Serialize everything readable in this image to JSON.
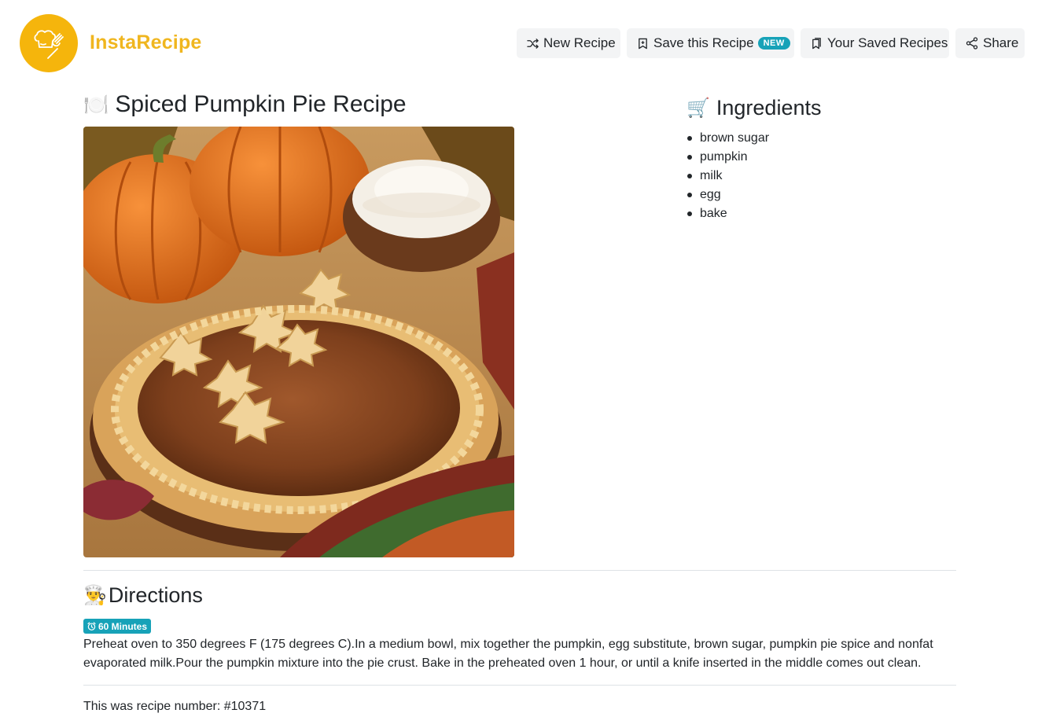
{
  "header": {
    "brand": "InstaRecipe",
    "buttons": {
      "new_recipe": "New Recipe",
      "save_recipe": "Save this Recipe",
      "save_badge": "NEW",
      "saved_recipes": "Your Saved Recipes",
      "share": "Share"
    }
  },
  "recipe": {
    "title_emoji": "🍽️",
    "title": "Spiced Pumpkin Pie Recipe",
    "ingredients_emoji": "🛒",
    "ingredients_heading": "Ingredients",
    "ingredients": [
      "brown sugar",
      "pumpkin",
      "milk",
      "egg",
      "bake"
    ],
    "directions_emoji": "👨‍🍳",
    "directions_heading": "Directions",
    "time": "60 Minutes",
    "directions": "Preheat oven to 350 degrees F (175 degrees C).In a medium bowl, mix together the pumpkin, egg substitute, brown sugar, pumpkin pie spice and nonfat evaporated milk.Pour the pumpkin mixture into the pie crust. Bake in the preheated oven 1 hour, or until a knife inserted in the middle comes out clean.",
    "footer": "This was recipe number: #10371"
  },
  "colors": {
    "brand": "#f0b61f",
    "logo_bg": "#f5b50c",
    "badge": "#17a2b8",
    "button_bg": "#f3f4f5"
  },
  "icons": [
    "chef-hat-logo-icon",
    "shuffle-icon",
    "bookmark-plus-icon",
    "bookmarks-icon",
    "share-icon",
    "alarm-clock-icon"
  ]
}
